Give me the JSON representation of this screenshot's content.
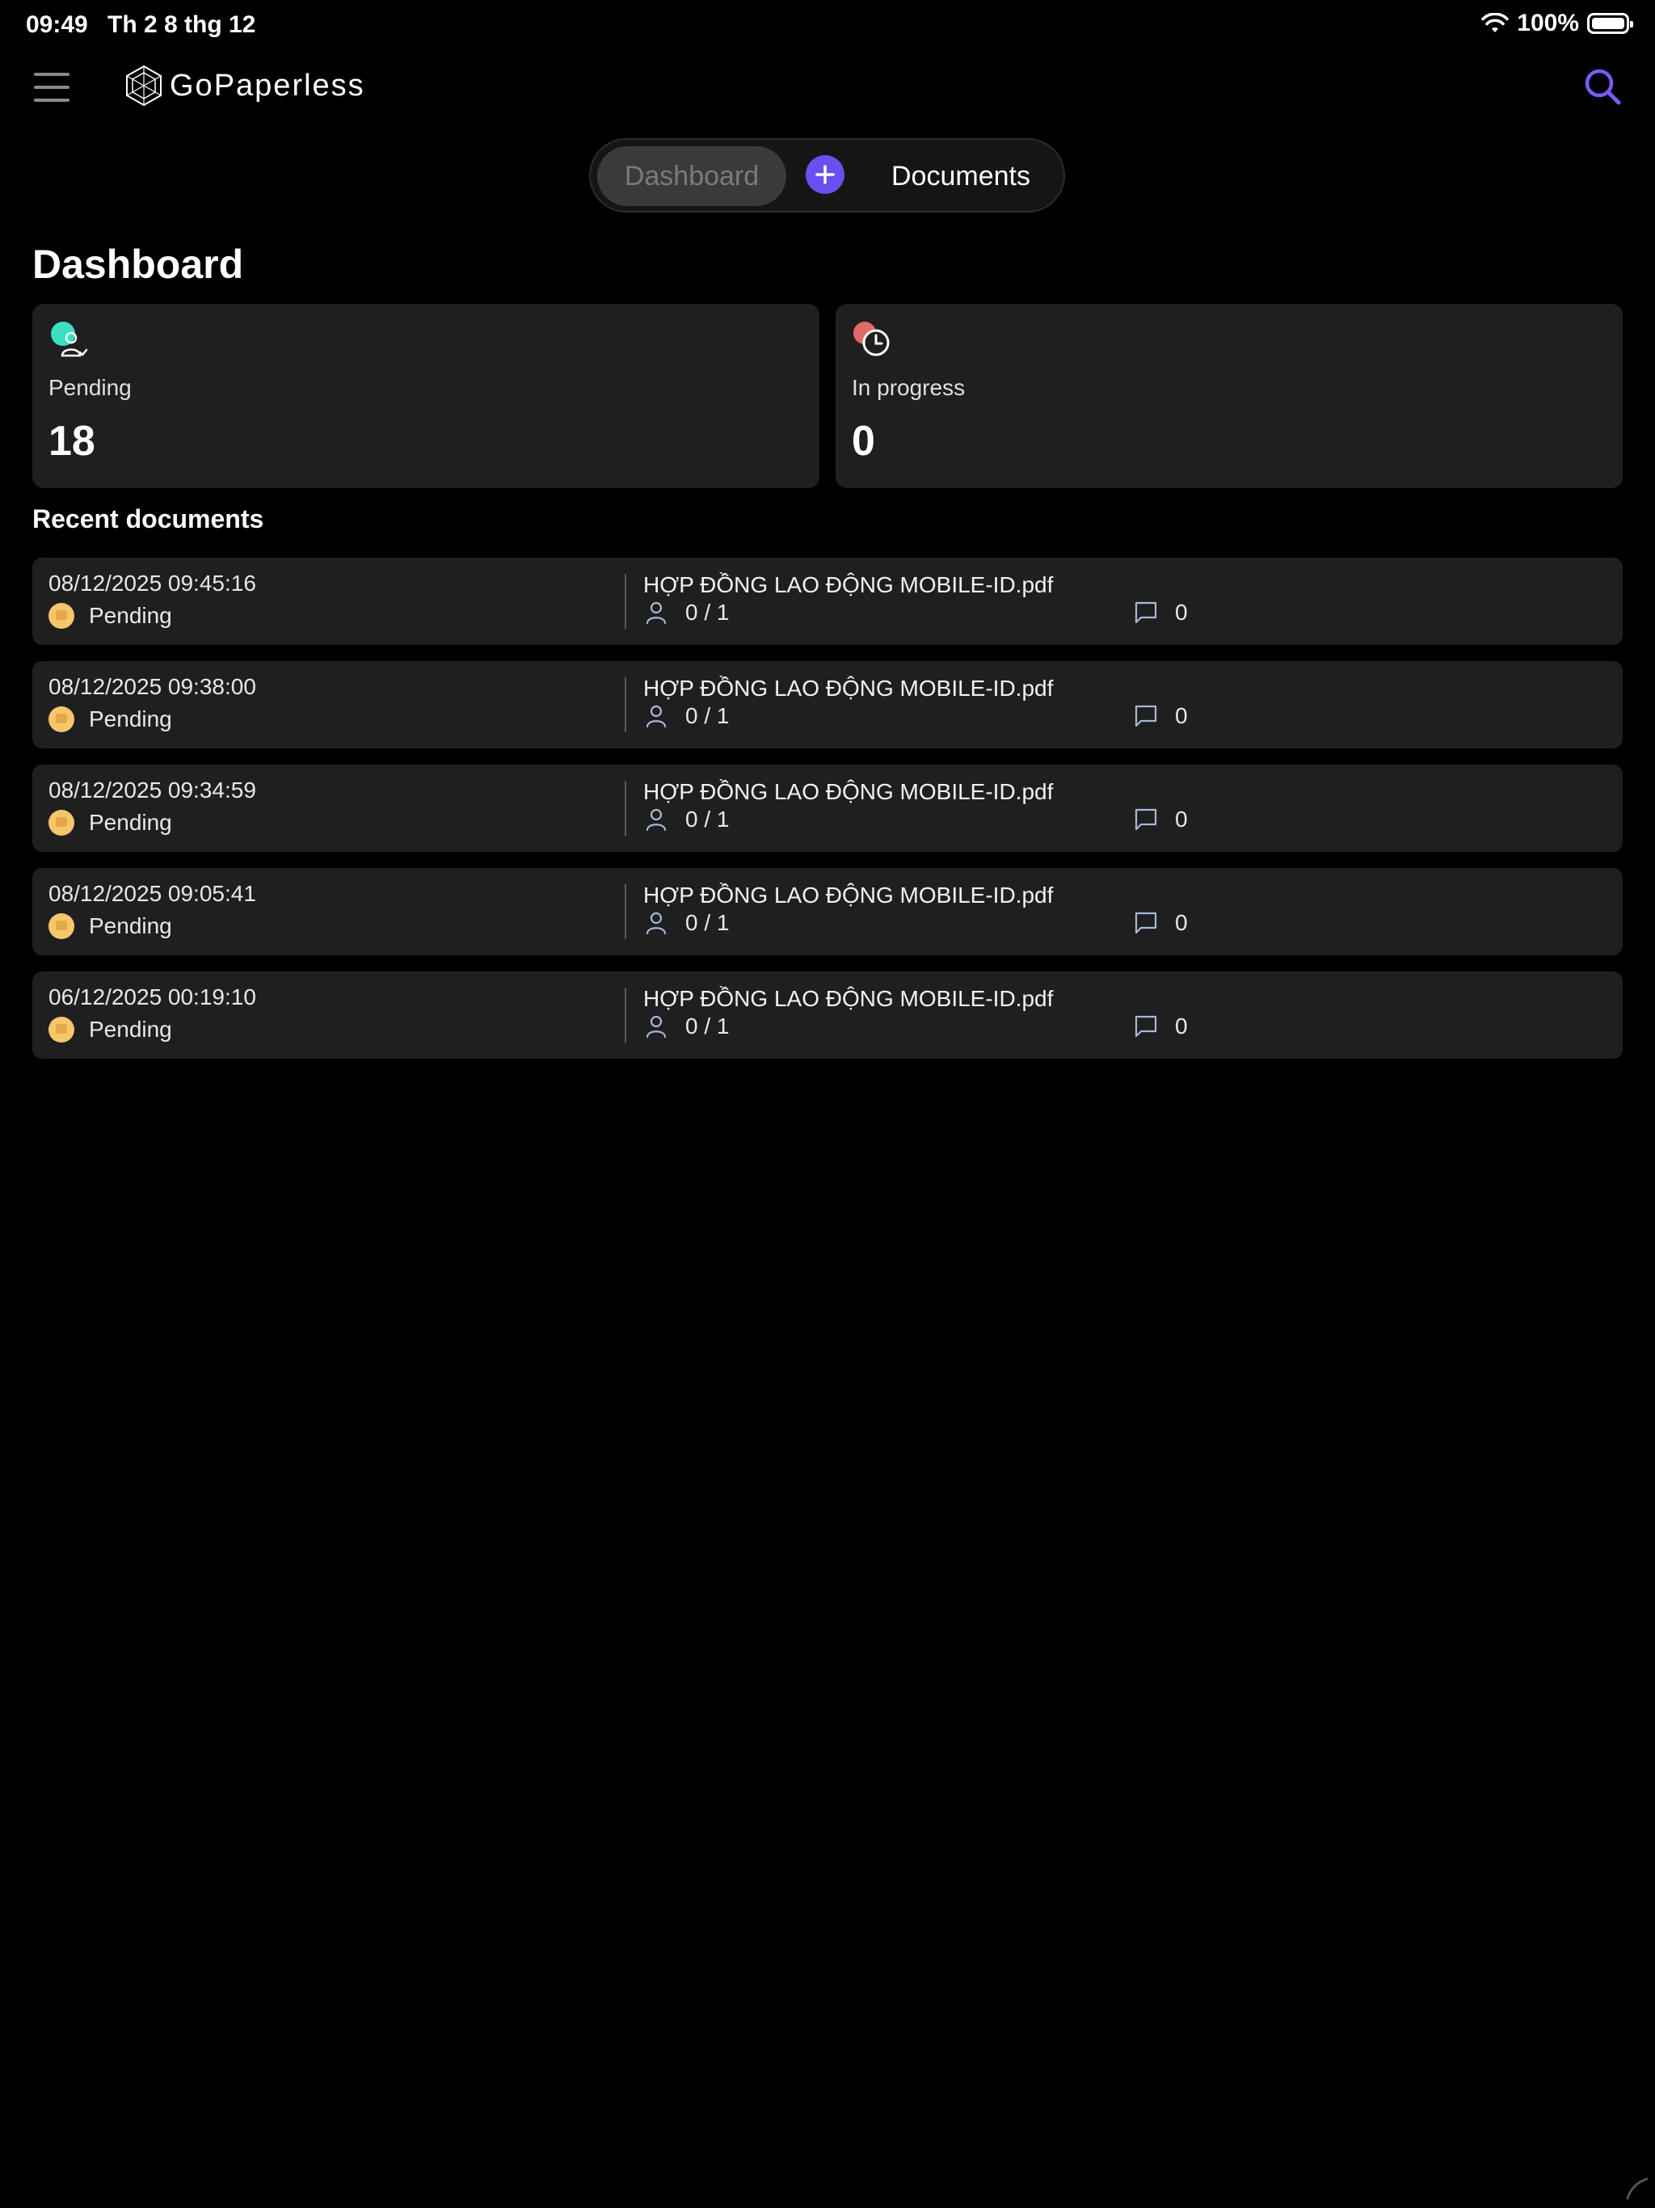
{
  "status_bar": {
    "time": "09:49",
    "date": "Th 2 8 thg 12",
    "battery": "100%"
  },
  "nav": {
    "brand": "GoPaperless",
    "menu_icon": "hamburger-icon",
    "search_icon": "search-icon"
  },
  "tabs": {
    "dashboard": "Dashboard",
    "documents": "Documents"
  },
  "page_title": "Dashboard",
  "stats": {
    "pending": {
      "label": "Pending",
      "value": "18",
      "color": "#3be0c0"
    },
    "in_progress": {
      "label": "In progress",
      "value": "0",
      "color": "#e06a6a"
    }
  },
  "recent": {
    "title": "Recent documents",
    "items": [
      {
        "date": "08/12/2025 09:45:16",
        "status": "Pending",
        "name": "HỢP ĐỒNG LAO ĐỘNG MOBILE-ID.pdf",
        "signers": "0 / 1",
        "comments": "0"
      },
      {
        "date": "08/12/2025 09:38:00",
        "status": "Pending",
        "name": "HỢP ĐỒNG LAO ĐỘNG MOBILE-ID.pdf",
        "signers": "0 / 1",
        "comments": "0"
      },
      {
        "date": "08/12/2025 09:34:59",
        "status": "Pending",
        "name": "HỢP ĐỒNG LAO ĐỘNG MOBILE-ID.pdf",
        "signers": "0 / 1",
        "comments": "0"
      },
      {
        "date": "08/12/2025 09:05:41",
        "status": "Pending",
        "name": "HỢP ĐỒNG LAO ĐỘNG MOBILE-ID.pdf",
        "signers": "0 / 1",
        "comments": "0"
      },
      {
        "date": "06/12/2025 00:19:10",
        "status": "Pending",
        "name": "HỢP ĐỒNG LAO ĐỘNG MOBILE-ID.pdf",
        "signers": "0 / 1",
        "comments": "0"
      }
    ]
  },
  "colors": {
    "accent": "#6a4ef0",
    "search": "#7b5af5",
    "card_bg": "#1f1f1f",
    "pending_badge": "#f6c66a"
  }
}
